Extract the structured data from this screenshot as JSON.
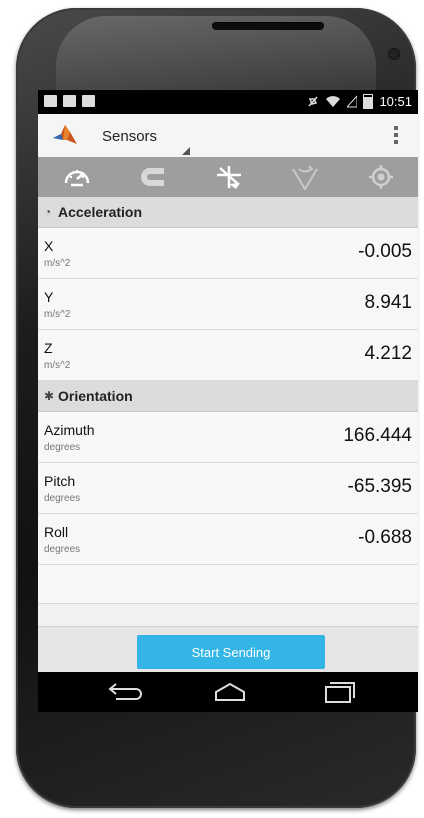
{
  "status_bar": {
    "time": "10:51"
  },
  "action_bar": {
    "title": "Sensors"
  },
  "tabs": [
    {
      "name": "speedometer-icon"
    },
    {
      "name": "magnet-icon"
    },
    {
      "name": "orientation-icon"
    },
    {
      "name": "angular-velocity-icon"
    },
    {
      "name": "location-icon"
    }
  ],
  "sections": {
    "acceleration": {
      "label": "Acceleration",
      "rows": [
        {
          "name": "X",
          "unit": "m/s^2",
          "value": "-0.005"
        },
        {
          "name": "Y",
          "unit": "m/s^2",
          "value": "8.941"
        },
        {
          "name": "Z",
          "unit": "m/s^2",
          "value": "4.212"
        }
      ]
    },
    "orientation": {
      "label": "Orientation",
      "rows": [
        {
          "name": "Azimuth",
          "unit": "degrees",
          "value": "166.444"
        },
        {
          "name": "Pitch",
          "unit": "degrees",
          "value": "-65.395"
        },
        {
          "name": "Roll",
          "unit": "degrees",
          "value": "-0.688"
        }
      ]
    }
  },
  "start_button": {
    "label": "Start Sending"
  },
  "colors": {
    "accent": "#33b5e5",
    "tabbar": "#9e9e9e",
    "section": "#dcdcdc"
  }
}
